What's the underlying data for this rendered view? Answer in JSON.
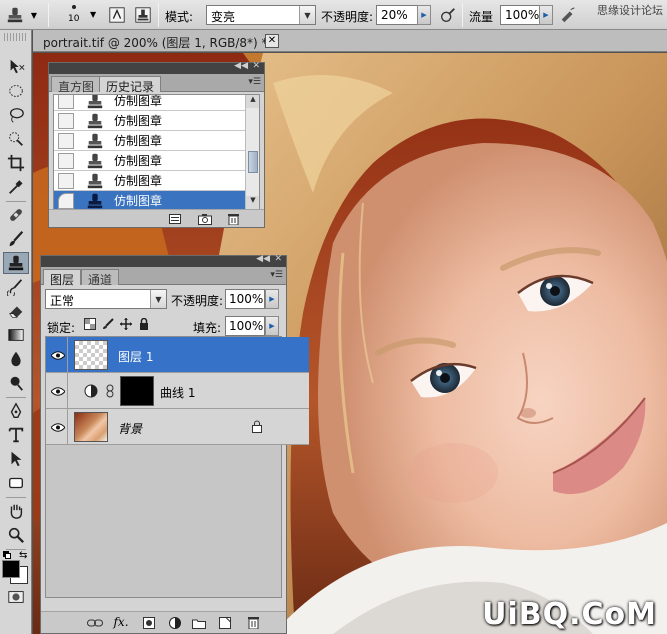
{
  "options_bar": {
    "brush_size": "10",
    "mode_label": "模式:",
    "mode_value": "变亮",
    "opacity_label": "不透明度:",
    "opacity_value": "20%",
    "flow_label": "流量",
    "flow_value": "100%"
  },
  "document": {
    "tab_title": "portrait.tif @ 200% (图层 1, RGB/8*) *",
    "close_glyph": "✕"
  },
  "history_panel": {
    "tabs": [
      {
        "label": "直方图",
        "active": false
      },
      {
        "label": "历史记录",
        "active": true
      }
    ],
    "items": [
      {
        "label": "仿制图章",
        "selected": false
      },
      {
        "label": "仿制图章",
        "selected": false
      },
      {
        "label": "仿制图章",
        "selected": false
      },
      {
        "label": "仿制图章",
        "selected": false
      },
      {
        "label": "仿制图章",
        "selected": false
      },
      {
        "label": "仿制图章",
        "selected": true
      }
    ]
  },
  "layers_panel": {
    "tabs": [
      {
        "label": "图层",
        "active": true
      },
      {
        "label": "通道",
        "active": false
      }
    ],
    "blend_mode": "正常",
    "opacity_label": "不透明度:",
    "opacity_value": "100%",
    "lock_label": "锁定:",
    "fill_label": "填充:",
    "fill_value": "100%",
    "layers": [
      {
        "name": "图层 1",
        "selected": true,
        "visible": true
      },
      {
        "name": "曲线 1",
        "selected": false,
        "visible": true
      },
      {
        "name": "背景",
        "selected": false,
        "visible": true,
        "locked": true
      }
    ]
  },
  "watermark": {
    "bottom": "UiBQ.CoM",
    "top": "思缘设计论坛"
  },
  "colors": {
    "selection_blue": "#3672c7",
    "panel_gray": "#d4d4d4",
    "workspace": "#535353"
  },
  "icons": {
    "tools": [
      "move-icon",
      "ellipse-marquee-icon",
      "lasso-icon",
      "quick-select-icon",
      "crop-icon",
      "eyedropper-icon",
      "healing-brush-icon",
      "brush-icon",
      "clone-stamp-icon",
      "history-brush-icon",
      "eraser-icon",
      "gradient-icon",
      "blur-icon",
      "dodge-icon",
      "pen-icon",
      "type-icon",
      "path-select-icon",
      "shape-icon",
      "hand-icon",
      "zoom-icon"
    ]
  }
}
